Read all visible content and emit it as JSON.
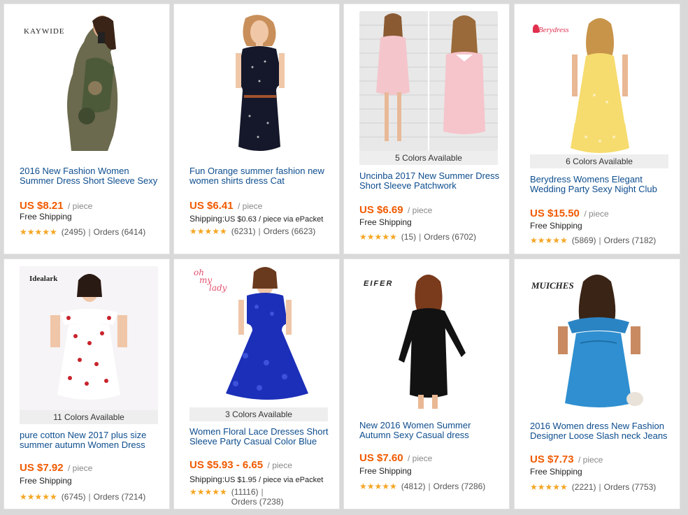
{
  "accent": "#f05a00",
  "link_color": "#0d4d8e",
  "star_color": "#f5a623",
  "star_icon": "★★★★★",
  "products": [
    {
      "brand": "KAYWIDE",
      "title": "2016 New Fashion Women Summer Dress Short Sleeve Sexy",
      "price": "US $8.21",
      "unit": "/ piece",
      "shipping": "Free Shipping",
      "reviews": "(2495)",
      "separator": "|",
      "orders": "Orders (6414)"
    },
    {
      "title": "Fun Orange summer fashion new women shirts dress Cat",
      "price": "US $6.41",
      "unit": "/ piece",
      "shipping_prefix": "Shipping:",
      "shipping_detail": "US $0.63 / piece via ePacket",
      "reviews": "(6231)",
      "separator": "|",
      "orders": "Orders (6623)"
    },
    {
      "colors": "5 Colors Available",
      "title": "Uncinba 2017 New Summer Dress Short Sleeve Patchwork",
      "price": "US $6.69",
      "unit": "/ piece",
      "shipping": "Free Shipping",
      "reviews": "(15)",
      "separator": "|",
      "orders": "Orders (6702)"
    },
    {
      "brand": "Berydress",
      "colors": "6 Colors Available",
      "title": "Berydress Womens Elegant Wedding Party Sexy Night Club",
      "price": "US $15.50",
      "unit": "/ piece",
      "shipping": "Free Shipping",
      "reviews": "(5869)",
      "separator": "|",
      "orders": "Orders (7182)"
    },
    {
      "brand": "Idealark",
      "colors": "11 Colors Available",
      "title": "pure cotton New 2017 plus size summer autumn Women Dress",
      "price": "US $7.92",
      "unit": "/ piece",
      "shipping": "Free Shipping",
      "reviews": "(6745)",
      "separator": "|",
      "orders": "Orders (7214)"
    },
    {
      "brand_line1": "oh",
      "brand_line2": "my",
      "brand_line3": "lady",
      "colors": "3 Colors Available",
      "title": "Women Floral Lace Dresses Short Sleeve Party Casual Color Blue",
      "price": "US $5.93 - 6.65",
      "unit": "/ piece",
      "shipping_prefix": "Shipping:",
      "shipping_detail": "US $1.95 / piece via ePacket",
      "reviews": "(11116)",
      "separator": "|",
      "orders": "Orders (7238)"
    },
    {
      "brand": "EIFER",
      "title": "New 2016 Women Summer Autumn Sexy Casual dress",
      "price": "US $7.60",
      "unit": "/ piece",
      "shipping": "Free Shipping",
      "reviews": "(4812)",
      "separator": "|",
      "orders": "Orders (7286)"
    },
    {
      "brand": "MUICHES",
      "title": "2016 Women dress New Fashion Designer Loose Slash neck Jeans",
      "price": "US $7.73",
      "unit": "/ piece",
      "shipping": "Free Shipping",
      "reviews": "(2221)",
      "separator": "|",
      "orders": "Orders (7753)"
    }
  ]
}
